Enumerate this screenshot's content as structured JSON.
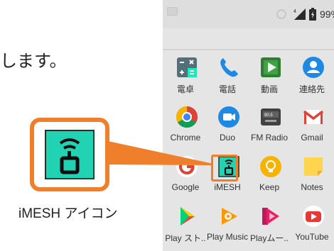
{
  "intro": {
    "text": "します。"
  },
  "status_bar": {
    "battery_text": "99%"
  },
  "apps": [
    {
      "label": "電卓",
      "icon": "calculator-icon"
    },
    {
      "label": "電話",
      "icon": "phone-icon"
    },
    {
      "label": "動画",
      "icon": "video-play-icon"
    },
    {
      "label": "連絡先",
      "icon": "contacts-icon"
    },
    {
      "label": "Chrome",
      "icon": "chrome-icon"
    },
    {
      "label": "Duo",
      "icon": "duo-icon"
    },
    {
      "label": "FM Radio",
      "icon": "fm-radio-icon"
    },
    {
      "label": "Gmail",
      "icon": "gmail-icon"
    },
    {
      "label": "Google",
      "icon": "google-icon"
    },
    {
      "label": "iMESH",
      "icon": "imesh-icon"
    },
    {
      "label": "Keep",
      "icon": "keep-icon"
    },
    {
      "label": "Notes",
      "icon": "notes-icon"
    },
    {
      "label": "Play スト..",
      "icon": "play-store-icon"
    },
    {
      "label": "Play Music",
      "icon": "play-music-icon"
    },
    {
      "label": "Playムー..",
      "icon": "play-movies-icon"
    },
    {
      "label": "YouTube",
      "icon": "youtube-icon"
    }
  ],
  "callout": {
    "caption": "iMESH アイコン",
    "accent_color": "#ef7f2b",
    "icon_color": "#22d3b3"
  }
}
